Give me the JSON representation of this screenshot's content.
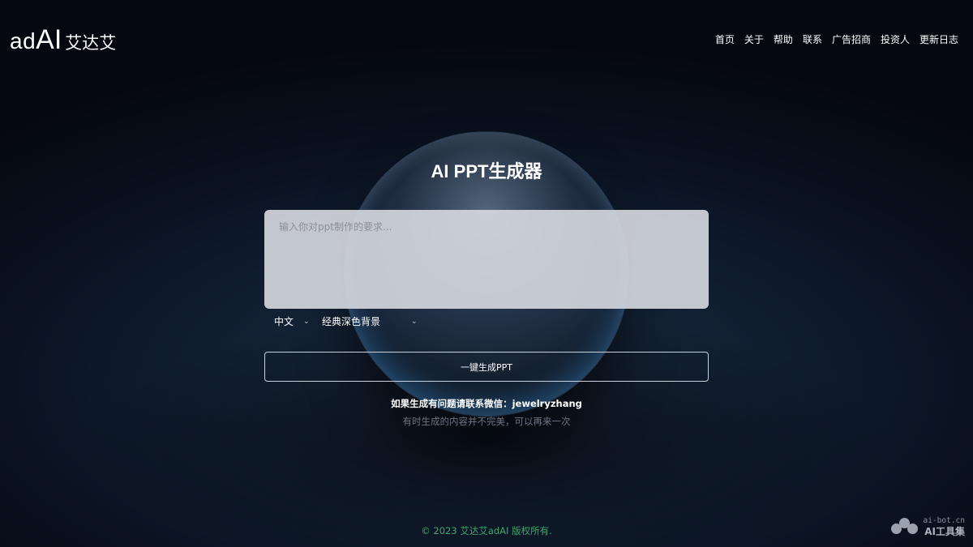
{
  "header": {
    "logo_ad": "ad",
    "logo_ai": "AI",
    "logo_cn": "艾达艾",
    "nav": [
      "首页",
      "关于",
      "帮助",
      "联系",
      "广告招商",
      "投资人",
      "更新日志"
    ]
  },
  "main": {
    "title": "AI PPT生成器",
    "prompt_placeholder": "输入你对ppt制作的要求...",
    "prompt_value": "",
    "language_select": "中文",
    "theme_select": "经典深色背景",
    "generate_button": "一键生成PPT",
    "contact_text": "如果生成有问题请联系微信：jewelryzhang",
    "note_text": "有时生成的内容并不完美，可以再来一次"
  },
  "footer": {
    "copyright": "© 2023 艾达艾adAI 版权所有."
  },
  "watermark": {
    "url": "ai-bot.cn",
    "name": "AI工具集"
  },
  "colors": {
    "footer_text": "#3fa86c",
    "background": "#0a1322"
  }
}
